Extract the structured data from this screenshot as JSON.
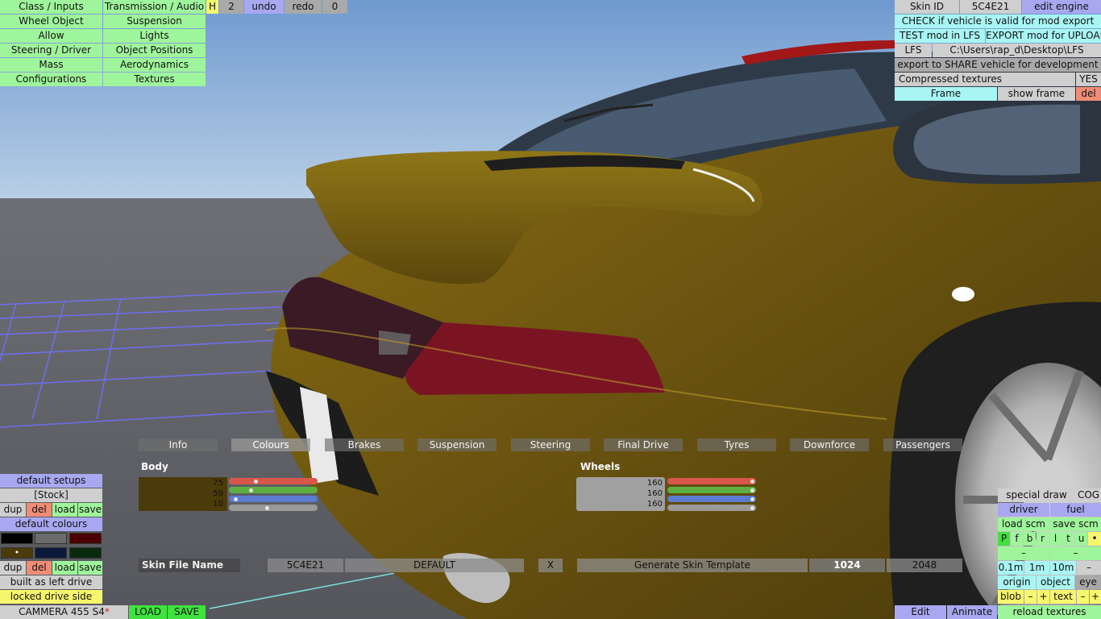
{
  "top_menu": {
    "col1": [
      "Class / Inputs",
      "Wheel Object",
      "Allow",
      "Steering / Driver",
      "Mass",
      "Configurations"
    ],
    "col2": [
      "Transmission / Audio",
      "Suspension",
      "Lights",
      "Object Positions",
      "Aerodynamics",
      "Textures"
    ],
    "h_label": "H",
    "count": "2",
    "undo": "undo",
    "redo": "redo",
    "zero": "0"
  },
  "top_right": {
    "skin_id_label": "Skin ID",
    "skin_id_value": "5C4E21",
    "edit_engine": "edit engine",
    "check_valid": "CHECK if vehicle is valid for mod export",
    "test_mod": "TEST mod in LFS",
    "export_mod": "EXPORT mod for UPLOAD",
    "lfs": "LFS",
    "path": "C:\\Users\\rap_d\\Desktop\\LFS",
    "export_share": "export to SHARE vehicle for development",
    "compressed": "Compressed textures",
    "compressed_val": "YES",
    "frame": "Frame",
    "show_frame": "show frame",
    "del": "del"
  },
  "tabs": [
    "Info",
    "Colours",
    "Brakes",
    "Suspension",
    "Steering",
    "Final Drive",
    "Tyres",
    "Downforce",
    "Passengers"
  ],
  "selected_tab": "Colours",
  "body": {
    "label": "Body",
    "r": "75",
    "g": "59",
    "b": "10",
    "r_frac": 0.29,
    "g_frac": 0.23,
    "b_frac": 0.04,
    "gray_frac": 0.43,
    "color": "#4b3b0a"
  },
  "wheels": {
    "label": "Wheels",
    "r": "160",
    "g": "160",
    "b": "160",
    "r_frac": 1.0,
    "g_frac": 1.0,
    "b_frac": 1.0,
    "gray_frac": 1.0,
    "color": "#a0a0a0"
  },
  "skin_row": {
    "label": "Skin File Name",
    "name": "5C4E21",
    "default": "DEFAULT",
    "x": "X",
    "generate": "Generate Skin Template",
    "size1": "1024",
    "size2": "2048"
  },
  "left_panel": {
    "default_setups": "default setups",
    "stock": "[Stock]",
    "dup": "dup",
    "del": "del",
    "load": "load",
    "save": "save",
    "default_colours": "default colours",
    "dup2": "dup",
    "del2": "del",
    "load2": "load",
    "save2": "save",
    "built": "built as left drive",
    "locked": "locked drive side",
    "car_name": "CAMMERA 455 S4",
    "asterisk": "*",
    "load_btn": "LOAD",
    "save_btn": "SAVE",
    "swatch_colors": [
      "#000000",
      "#6b6b6b",
      "#4a0000",
      "#4b3b0a",
      "#0b1a3a",
      "#0a2a10"
    ],
    "dot": "•"
  },
  "right_panel": {
    "special_draw": "special draw",
    "cog": "COG",
    "driver": "driver",
    "fuel": "fuel",
    "load_scm": "load scm",
    "save_scm": "save scm",
    "letters": [
      "P",
      "f",
      "b",
      "r",
      "l",
      "t",
      "u",
      "•"
    ],
    "minus1": "–",
    "minus2": "–",
    "step1": "0.1m",
    "step2": "1m",
    "step3": "10m",
    "minus3": "–",
    "origin": "origin",
    "object": "object",
    "eye": "eye",
    "blob": "blob",
    "bminus": "–",
    "bplus": "+",
    "text": "text",
    "tminus": "–",
    "tplus": "+",
    "edit": "Edit",
    "animate": "Animate",
    "reload": "reload textures"
  }
}
